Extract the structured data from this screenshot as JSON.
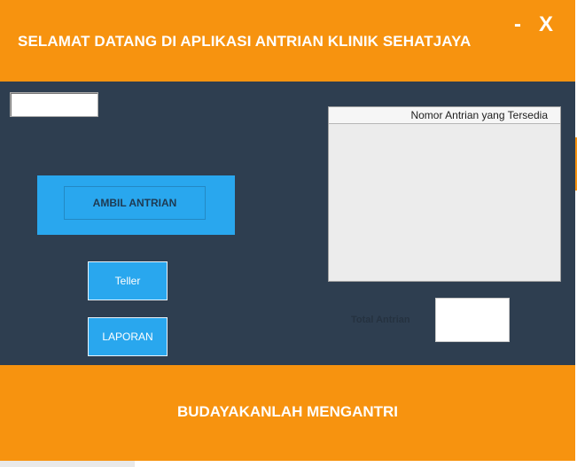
{
  "window": {
    "title": "SELAMAT DATANG DI APLIKASI ANTRIAN KLINIK SEHATJAYA",
    "minimize_label": "-",
    "close_label": "X"
  },
  "main": {
    "queue_input_value": "",
    "ambil_antrian_label": "AMBIL ANTRIAN",
    "teller_label": "Teller",
    "laporan_label": "LAPORAN",
    "table": {
      "columns": [
        "Nomor Antrian yang Tersedia"
      ],
      "rows": []
    },
    "total_antrian_label": "Total Antrian",
    "total_antrian_value": ""
  },
  "footer": {
    "text": "BUDAYAKANLAH MENGANTRI"
  },
  "colors": {
    "header_orange": "#f7930f",
    "panel_dark": "#2e3e50",
    "button_blue": "#29a7ee"
  }
}
